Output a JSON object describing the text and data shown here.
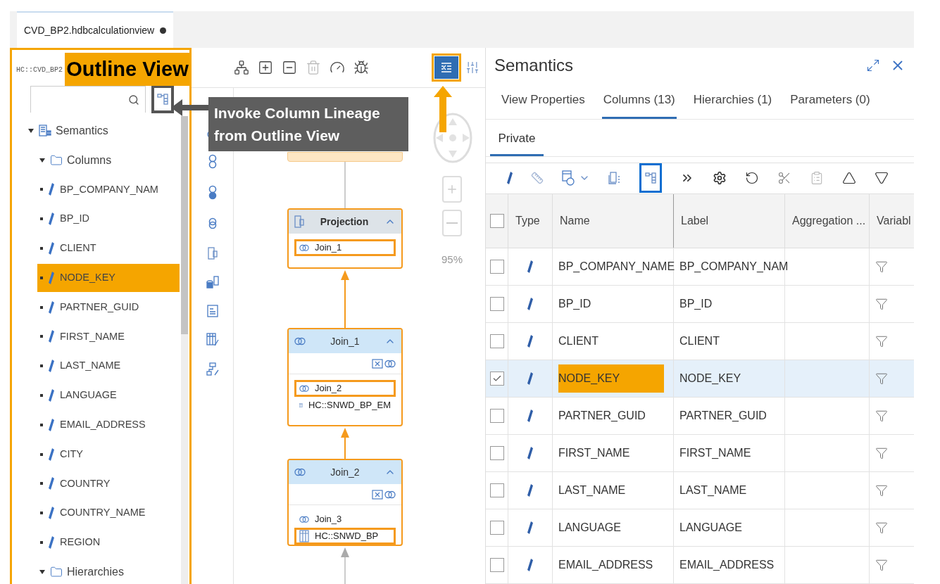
{
  "editor_tabs": [
    {
      "label": "CVD_BP2.hdbcalculationview",
      "dirty": true,
      "selected": true
    }
  ],
  "outline": {
    "title": "HC::CVD_BP2",
    "tree": [
      {
        "label": "Semantics",
        "kind": "semantics",
        "expanded": true,
        "children": [
          {
            "label": "Columns",
            "kind": "folder",
            "expanded": true,
            "children": [
              {
                "label": "BP_COMPANY_NAM",
                "kind": "column",
                "highlighted": false
              },
              {
                "label": "BP_ID",
                "kind": "column",
                "highlighted": false
              },
              {
                "label": "CLIENT",
                "kind": "column",
                "highlighted": false
              },
              {
                "label": "NODE_KEY",
                "kind": "column",
                "highlighted": true
              },
              {
                "label": "PARTNER_GUID",
                "kind": "column",
                "highlighted": false
              },
              {
                "label": "FIRST_NAME",
                "kind": "column",
                "highlighted": false
              },
              {
                "label": "LAST_NAME",
                "kind": "column",
                "highlighted": false
              },
              {
                "label": "LANGUAGE",
                "kind": "column",
                "highlighted": false
              },
              {
                "label": "EMAIL_ADDRESS",
                "kind": "column",
                "highlighted": false
              },
              {
                "label": "CITY",
                "kind": "column",
                "highlighted": false
              },
              {
                "label": "COUNTRY",
                "kind": "column",
                "highlighted": false
              },
              {
                "label": "COUNTRY_NAME",
                "kind": "column",
                "highlighted": false
              },
              {
                "label": "REGION",
                "kind": "column",
                "highlighted": false
              }
            ]
          },
          {
            "label": "Hierarchies",
            "kind": "folder",
            "expanded": true
          }
        ]
      }
    ]
  },
  "editor": {
    "outline_toggle": {
      "on": true
    },
    "zoom": "95%",
    "nodes": [
      {
        "kind": "projection",
        "title": "Projection",
        "inputs": [
          {
            "kind": "join",
            "label": "Join_1",
            "highlighted": true
          }
        ]
      },
      {
        "kind": "join",
        "title": "Join_1",
        "inputs": [
          {
            "kind": "join",
            "label": "Join_2",
            "highlighted": true
          },
          {
            "kind": "table",
            "label": "HC::SNWD_BP_EM",
            "highlighted": false
          }
        ]
      },
      {
        "kind": "join",
        "title": "Join_2",
        "inputs": [
          {
            "kind": "join",
            "label": "Join_3",
            "highlighted": false
          },
          {
            "kind": "table",
            "label": "HC::SNWD_BP",
            "highlighted": true
          }
        ]
      }
    ],
    "edges": [
      {
        "highlighted": false
      },
      {
        "highlighted": true
      },
      {
        "highlighted": true
      },
      {
        "highlighted": false
      }
    ]
  },
  "callouts": [
    {
      "kind": "title",
      "text": "Outline View"
    },
    {
      "kind": "note",
      "text": "Invoke Column Lineage from Outline View"
    }
  ],
  "semantics": {
    "title": "Semantics",
    "tabs": [
      {
        "label": "View Properties",
        "selected": false
      },
      {
        "label": "Columns (13)",
        "selected": true
      },
      {
        "label": "Hierarchies (1)",
        "selected": false
      },
      {
        "label": "Parameters (0)",
        "selected": false
      }
    ],
    "subtabs": [
      {
        "label": "Private",
        "selected": true
      }
    ],
    "lineage_button": {
      "focused": true
    },
    "table": {
      "all_checked": false,
      "columns": [
        "Type",
        "Name",
        "Label",
        "Aggregation ...",
        "Variabl"
      ],
      "rows": [
        {
          "name": "BP_COMPANY_NAME",
          "label": "BP_COMPANY_NAM",
          "checked": false,
          "highlighted": false
        },
        {
          "name": "BP_ID",
          "label": "BP_ID",
          "checked": false,
          "highlighted": false
        },
        {
          "name": "CLIENT",
          "label": "CLIENT",
          "checked": false,
          "highlighted": false
        },
        {
          "name": "NODE_KEY",
          "label": "NODE_KEY",
          "checked": true,
          "highlighted": true
        },
        {
          "name": "PARTNER_GUID",
          "label": "PARTNER_GUID",
          "checked": false,
          "highlighted": false
        },
        {
          "name": "FIRST_NAME",
          "label": "FIRST_NAME",
          "checked": false,
          "highlighted": false
        },
        {
          "name": "LAST_NAME",
          "label": "LAST_NAME",
          "checked": false,
          "highlighted": false
        },
        {
          "name": "LANGUAGE",
          "label": "LANGUAGE",
          "checked": false,
          "highlighted": false
        },
        {
          "name": "EMAIL_ADDRESS",
          "label": "EMAIL_ADDRESS",
          "checked": false,
          "highlighted": false
        }
      ]
    }
  }
}
